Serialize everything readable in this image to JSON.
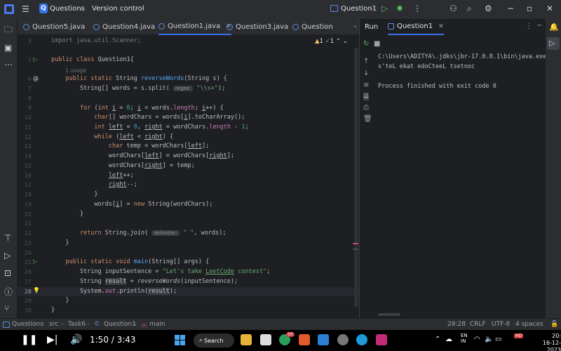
{
  "topbar": {
    "project_chip": "Q",
    "project_name": "Questions",
    "vcs_label": "Version control",
    "run_config": "Question1"
  },
  "editor_tabs": [
    {
      "label": "Question5.java",
      "active": false
    },
    {
      "label": "Question4.java",
      "active": false
    },
    {
      "label": "Question1.java",
      "active": true
    },
    {
      "label": "Question3.java",
      "active": false
    },
    {
      "label": "Question",
      "active": false
    }
  ],
  "inspections": {
    "warnings": "1",
    "ok": "1"
  },
  "gutter": {
    "lines": [
      "3",
      "5",
      "",
      "6",
      "7",
      "8",
      "9",
      "10",
      "11",
      "12",
      "13",
      "14",
      "15",
      "16",
      "17",
      "18",
      "19",
      "20",
      "21",
      "22",
      "23",
      "24",
      "25",
      "26",
      "27",
      "28",
      "29",
      "30"
    ],
    "current_line": "28"
  },
  "code": {
    "l3": "import java.util.Scanner;",
    "usages": "1 usage",
    "regex_hint": "regex:",
    "delimiter_hint": "delimiter:"
  },
  "run_panel": {
    "title": "Run",
    "tab": "Question1",
    "console": [
      "C:\\Users\\ADITYA\\.jdks\\jbr-17.0.8.1\\bin\\java.exe",
      "s'teL ekat edoCteeL tsetnoc",
      "",
      "Process finished with exit code 0"
    ]
  },
  "statusbar": {
    "breadcrumb": [
      "Questions",
      "src",
      "Task6",
      "Question1",
      "main"
    ],
    "position": "28:28",
    "line_sep": "CRLF",
    "encoding": "UTF-8",
    "indent": "4 spaces"
  },
  "media": {
    "time": "1:50 / 3:43"
  },
  "taskbar": {
    "search": "Search",
    "lang": "EN",
    "lang2": "IN",
    "time": "20:",
    "date": "16-12-2023",
    "badge": "50",
    "hd": "HD"
  }
}
